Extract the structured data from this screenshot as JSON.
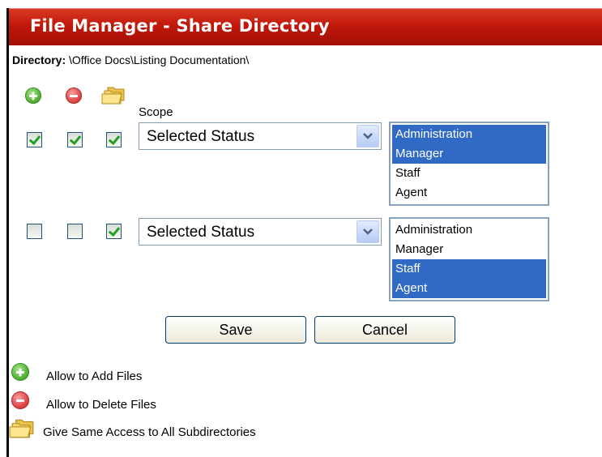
{
  "window": {
    "title": "File Manager - Share Directory"
  },
  "directory": {
    "label": "Directory:",
    "path": "\\Office Docs\\Listing Documentation\\"
  },
  "header": {
    "scope_label": "Scope"
  },
  "rows": [
    {
      "add_checked": true,
      "delete_checked": true,
      "subdir_checked": true,
      "status_value": "Selected Status",
      "options": [
        "Administration",
        "Manager",
        "Staff",
        "Agent"
      ],
      "selected": [
        true,
        true,
        false,
        false
      ]
    },
    {
      "add_checked": false,
      "delete_checked": false,
      "subdir_checked": true,
      "status_value": "Selected Status",
      "options": [
        "Administration",
        "Manager",
        "Staff",
        "Agent"
      ],
      "selected": [
        false,
        false,
        true,
        true
      ]
    }
  ],
  "buttons": {
    "save": "Save",
    "cancel": "Cancel"
  },
  "legend": {
    "add": "Allow to Add Files",
    "delete": "Allow to Delete Files",
    "subdirs": "Give Same Access to All Subdirectories"
  },
  "colors": {
    "titlebar": "#c0180b",
    "selection": "#316ac5",
    "check": "#21a121"
  },
  "icons": {
    "add": "plus-circle-icon",
    "delete": "minus-circle-icon",
    "subdirs": "folders-icon"
  }
}
